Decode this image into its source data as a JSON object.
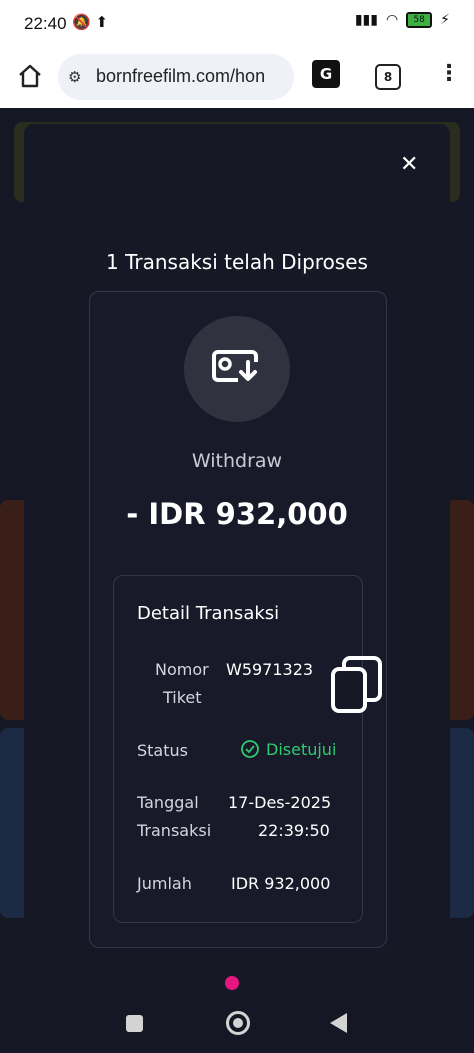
{
  "status_bar": {
    "time": "22:40",
    "battery": "58"
  },
  "browser": {
    "url": "bornfreefilm.com/hon",
    "tab_count": "8",
    "translate_label": "G"
  },
  "modal": {
    "heading": "1 Transaksi telah Diproses",
    "transaction_type": "Withdraw",
    "amount": "- IDR 932,000",
    "detail": {
      "title": "Detail Transaksi",
      "ticket_label_line1": "Nomor",
      "ticket_label_line2": "Tiket",
      "ticket_value": "W5971323",
      "status_label": "Status",
      "status_value": "Disetujui",
      "date_label_line1": "Tanggal",
      "date_label_line2": "Transaksi",
      "date_value": "17-Des-2025",
      "time_value": "22:39:50",
      "amount_label": "Jumlah",
      "amount_value": "IDR 932,000"
    }
  },
  "colors": {
    "accent_pink": "#e5167f",
    "approved_green": "#2fcb6f",
    "modal_bg": "#161826"
  }
}
